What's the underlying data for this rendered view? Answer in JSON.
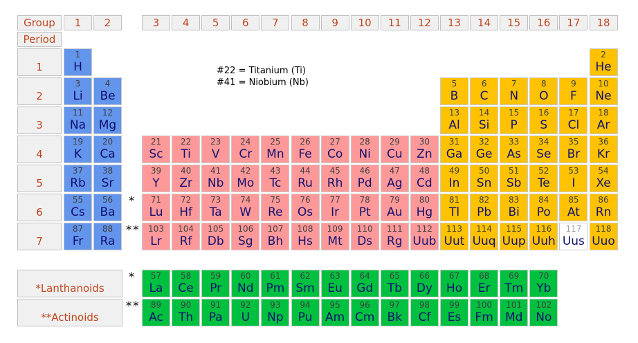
{
  "headers": {
    "group_label": "Group",
    "period_label": "Period",
    "groups": [
      "1",
      "2",
      "3",
      "4",
      "5",
      "6",
      "7",
      "8",
      "9",
      "10",
      "11",
      "12",
      "13",
      "14",
      "15",
      "16",
      "17",
      "18"
    ],
    "periods": [
      "1",
      "2",
      "3",
      "4",
      "5",
      "6",
      "7"
    ]
  },
  "notes": [
    "#22 = Titanium (Ti)",
    "#41 = Niobium (Nb)"
  ],
  "series_labels": {
    "lanthanoids": "*Lanthanoids",
    "actinoids": "**Actinoids",
    "lanthanoid_marker": "*",
    "actinoid_marker": "**"
  },
  "category_colors": {
    "s": "#6495ed",
    "d": "#ff9999",
    "p": "#ffc200",
    "f": "#00c040",
    "unknown": "#ffffff"
  },
  "elements": [
    {
      "n": 1,
      "sym": "H",
      "period": 1,
      "group": 1,
      "cat": "s"
    },
    {
      "n": 2,
      "sym": "He",
      "period": 1,
      "group": 18,
      "cat": "p"
    },
    {
      "n": 3,
      "sym": "Li",
      "period": 2,
      "group": 1,
      "cat": "s"
    },
    {
      "n": 4,
      "sym": "Be",
      "period": 2,
      "group": 2,
      "cat": "s"
    },
    {
      "n": 5,
      "sym": "B",
      "period": 2,
      "group": 13,
      "cat": "p"
    },
    {
      "n": 6,
      "sym": "C",
      "period": 2,
      "group": 14,
      "cat": "p"
    },
    {
      "n": 7,
      "sym": "N",
      "period": 2,
      "group": 15,
      "cat": "p"
    },
    {
      "n": 8,
      "sym": "O",
      "period": 2,
      "group": 16,
      "cat": "p"
    },
    {
      "n": 9,
      "sym": "F",
      "period": 2,
      "group": 17,
      "cat": "p"
    },
    {
      "n": 10,
      "sym": "Ne",
      "period": 2,
      "group": 18,
      "cat": "p"
    },
    {
      "n": 11,
      "sym": "Na",
      "period": 3,
      "group": 1,
      "cat": "s"
    },
    {
      "n": 12,
      "sym": "Mg",
      "period": 3,
      "group": 2,
      "cat": "s"
    },
    {
      "n": 13,
      "sym": "Al",
      "period": 3,
      "group": 13,
      "cat": "p"
    },
    {
      "n": 14,
      "sym": "Si",
      "period": 3,
      "group": 14,
      "cat": "p"
    },
    {
      "n": 15,
      "sym": "P",
      "period": 3,
      "group": 15,
      "cat": "p"
    },
    {
      "n": 16,
      "sym": "S",
      "period": 3,
      "group": 16,
      "cat": "p"
    },
    {
      "n": 17,
      "sym": "Cl",
      "period": 3,
      "group": 17,
      "cat": "p"
    },
    {
      "n": 18,
      "sym": "Ar",
      "period": 3,
      "group": 18,
      "cat": "p"
    },
    {
      "n": 19,
      "sym": "K",
      "period": 4,
      "group": 1,
      "cat": "s"
    },
    {
      "n": 20,
      "sym": "Ca",
      "period": 4,
      "group": 2,
      "cat": "s"
    },
    {
      "n": 21,
      "sym": "Sc",
      "period": 4,
      "group": 3,
      "cat": "d"
    },
    {
      "n": 22,
      "sym": "Ti",
      "period": 4,
      "group": 4,
      "cat": "d"
    },
    {
      "n": 23,
      "sym": "V",
      "period": 4,
      "group": 5,
      "cat": "d"
    },
    {
      "n": 24,
      "sym": "Cr",
      "period": 4,
      "group": 6,
      "cat": "d"
    },
    {
      "n": 25,
      "sym": "Mn",
      "period": 4,
      "group": 7,
      "cat": "d"
    },
    {
      "n": 26,
      "sym": "Fe",
      "period": 4,
      "group": 8,
      "cat": "d"
    },
    {
      "n": 27,
      "sym": "Co",
      "period": 4,
      "group": 9,
      "cat": "d"
    },
    {
      "n": 28,
      "sym": "Ni",
      "period": 4,
      "group": 10,
      "cat": "d"
    },
    {
      "n": 29,
      "sym": "Cu",
      "period": 4,
      "group": 11,
      "cat": "d"
    },
    {
      "n": 30,
      "sym": "Zn",
      "period": 4,
      "group": 12,
      "cat": "d"
    },
    {
      "n": 31,
      "sym": "Ga",
      "period": 4,
      "group": 13,
      "cat": "p"
    },
    {
      "n": 32,
      "sym": "Ge",
      "period": 4,
      "group": 14,
      "cat": "p"
    },
    {
      "n": 33,
      "sym": "As",
      "period": 4,
      "group": 15,
      "cat": "p"
    },
    {
      "n": 34,
      "sym": "Se",
      "period": 4,
      "group": 16,
      "cat": "p"
    },
    {
      "n": 35,
      "sym": "Br",
      "period": 4,
      "group": 17,
      "cat": "p"
    },
    {
      "n": 36,
      "sym": "Kr",
      "period": 4,
      "group": 18,
      "cat": "p"
    },
    {
      "n": 37,
      "sym": "Rb",
      "period": 5,
      "group": 1,
      "cat": "s"
    },
    {
      "n": 38,
      "sym": "Sr",
      "period": 5,
      "group": 2,
      "cat": "s"
    },
    {
      "n": 39,
      "sym": "Y",
      "period": 5,
      "group": 3,
      "cat": "d"
    },
    {
      "n": 40,
      "sym": "Zr",
      "period": 5,
      "group": 4,
      "cat": "d"
    },
    {
      "n": 41,
      "sym": "Nb",
      "period": 5,
      "group": 5,
      "cat": "d"
    },
    {
      "n": 42,
      "sym": "Mo",
      "period": 5,
      "group": 6,
      "cat": "d"
    },
    {
      "n": 43,
      "sym": "Tc",
      "period": 5,
      "group": 7,
      "cat": "d"
    },
    {
      "n": 44,
      "sym": "Ru",
      "period": 5,
      "group": 8,
      "cat": "d"
    },
    {
      "n": 45,
      "sym": "Rh",
      "period": 5,
      "group": 9,
      "cat": "d"
    },
    {
      "n": 46,
      "sym": "Pd",
      "period": 5,
      "group": 10,
      "cat": "d"
    },
    {
      "n": 47,
      "sym": "Ag",
      "period": 5,
      "group": 11,
      "cat": "d"
    },
    {
      "n": 48,
      "sym": "Cd",
      "period": 5,
      "group": 12,
      "cat": "d"
    },
    {
      "n": 49,
      "sym": "In",
      "period": 5,
      "group": 13,
      "cat": "p"
    },
    {
      "n": 50,
      "sym": "Sn",
      "period": 5,
      "group": 14,
      "cat": "p"
    },
    {
      "n": 51,
      "sym": "Sb",
      "period": 5,
      "group": 15,
      "cat": "p"
    },
    {
      "n": 52,
      "sym": "Te",
      "period": 5,
      "group": 16,
      "cat": "p"
    },
    {
      "n": 53,
      "sym": "I",
      "period": 5,
      "group": 17,
      "cat": "p"
    },
    {
      "n": 54,
      "sym": "Xe",
      "period": 5,
      "group": 18,
      "cat": "p"
    },
    {
      "n": 55,
      "sym": "Cs",
      "period": 6,
      "group": 1,
      "cat": "s"
    },
    {
      "n": 56,
      "sym": "Ba",
      "period": 6,
      "group": 2,
      "cat": "s"
    },
    {
      "n": 71,
      "sym": "Lu",
      "period": 6,
      "group": 3,
      "cat": "d"
    },
    {
      "n": 72,
      "sym": "Hf",
      "period": 6,
      "group": 4,
      "cat": "d"
    },
    {
      "n": 73,
      "sym": "Ta",
      "period": 6,
      "group": 5,
      "cat": "d"
    },
    {
      "n": 74,
      "sym": "W",
      "period": 6,
      "group": 6,
      "cat": "d"
    },
    {
      "n": 75,
      "sym": "Re",
      "period": 6,
      "group": 7,
      "cat": "d"
    },
    {
      "n": 76,
      "sym": "Os",
      "period": 6,
      "group": 8,
      "cat": "d"
    },
    {
      "n": 77,
      "sym": "Ir",
      "period": 6,
      "group": 9,
      "cat": "d"
    },
    {
      "n": 78,
      "sym": "Pt",
      "period": 6,
      "group": 10,
      "cat": "d"
    },
    {
      "n": 79,
      "sym": "Au",
      "period": 6,
      "group": 11,
      "cat": "d"
    },
    {
      "n": 80,
      "sym": "Hg",
      "period": 6,
      "group": 12,
      "cat": "d"
    },
    {
      "n": 81,
      "sym": "Tl",
      "period": 6,
      "group": 13,
      "cat": "p"
    },
    {
      "n": 82,
      "sym": "Pb",
      "period": 6,
      "group": 14,
      "cat": "p"
    },
    {
      "n": 83,
      "sym": "Bi",
      "period": 6,
      "group": 15,
      "cat": "p"
    },
    {
      "n": 84,
      "sym": "Po",
      "period": 6,
      "group": 16,
      "cat": "p"
    },
    {
      "n": 85,
      "sym": "At",
      "period": 6,
      "group": 17,
      "cat": "p"
    },
    {
      "n": 86,
      "sym": "Rn",
      "period": 6,
      "group": 18,
      "cat": "p"
    },
    {
      "n": 87,
      "sym": "Fr",
      "period": 7,
      "group": 1,
      "cat": "s"
    },
    {
      "n": 88,
      "sym": "Ra",
      "period": 7,
      "group": 2,
      "cat": "s"
    },
    {
      "n": 103,
      "sym": "Lr",
      "period": 7,
      "group": 3,
      "cat": "d"
    },
    {
      "n": 104,
      "sym": "Rf",
      "period": 7,
      "group": 4,
      "cat": "d"
    },
    {
      "n": 105,
      "sym": "Db",
      "period": 7,
      "group": 5,
      "cat": "d"
    },
    {
      "n": 106,
      "sym": "Sg",
      "period": 7,
      "group": 6,
      "cat": "d"
    },
    {
      "n": 107,
      "sym": "Bh",
      "period": 7,
      "group": 7,
      "cat": "d"
    },
    {
      "n": 108,
      "sym": "Hs",
      "period": 7,
      "group": 8,
      "cat": "d"
    },
    {
      "n": 109,
      "sym": "Mt",
      "period": 7,
      "group": 9,
      "cat": "d"
    },
    {
      "n": 110,
      "sym": "Ds",
      "period": 7,
      "group": 10,
      "cat": "d"
    },
    {
      "n": 111,
      "sym": "Rg",
      "period": 7,
      "group": 11,
      "cat": "d"
    },
    {
      "n": 112,
      "sym": "Uub",
      "period": 7,
      "group": 12,
      "cat": "d"
    },
    {
      "n": 113,
      "sym": "Uut",
      "period": 7,
      "group": 13,
      "cat": "p"
    },
    {
      "n": 114,
      "sym": "Uuq",
      "period": 7,
      "group": 14,
      "cat": "p"
    },
    {
      "n": 115,
      "sym": "Uup",
      "period": 7,
      "group": 15,
      "cat": "p"
    },
    {
      "n": 116,
      "sym": "Uuh",
      "period": 7,
      "group": 16,
      "cat": "p"
    },
    {
      "n": 117,
      "sym": "Uus",
      "period": 7,
      "group": 17,
      "cat": "unknown"
    },
    {
      "n": 118,
      "sym": "Uuo",
      "period": 7,
      "group": 18,
      "cat": "p"
    }
  ],
  "lanthanoids": [
    {
      "n": 57,
      "sym": "La"
    },
    {
      "n": 58,
      "sym": "Ce"
    },
    {
      "n": 59,
      "sym": "Pr"
    },
    {
      "n": 60,
      "sym": "Nd"
    },
    {
      "n": 61,
      "sym": "Pm"
    },
    {
      "n": 62,
      "sym": "Sm"
    },
    {
      "n": 63,
      "sym": "Eu"
    },
    {
      "n": 64,
      "sym": "Gd"
    },
    {
      "n": 65,
      "sym": "Tb"
    },
    {
      "n": 66,
      "sym": "Dy"
    },
    {
      "n": 67,
      "sym": "Ho"
    },
    {
      "n": 68,
      "sym": "Er"
    },
    {
      "n": 69,
      "sym": "Tm"
    },
    {
      "n": 70,
      "sym": "Yb"
    }
  ],
  "actinoids": [
    {
      "n": 89,
      "sym": "Ac"
    },
    {
      "n": 90,
      "sym": "Th"
    },
    {
      "n": 91,
      "sym": "Pa"
    },
    {
      "n": 92,
      "sym": "U"
    },
    {
      "n": 93,
      "sym": "Np"
    },
    {
      "n": 94,
      "sym": "Pu"
    },
    {
      "n": 95,
      "sym": "Am"
    },
    {
      "n": 96,
      "sym": "Cm"
    },
    {
      "n": 97,
      "sym": "Bk"
    },
    {
      "n": 98,
      "sym": "Cf"
    },
    {
      "n": 99,
      "sym": "Es"
    },
    {
      "n": 100,
      "sym": "Fm"
    },
    {
      "n": 101,
      "sym": "Md"
    },
    {
      "n": 102,
      "sym": "No"
    }
  ]
}
